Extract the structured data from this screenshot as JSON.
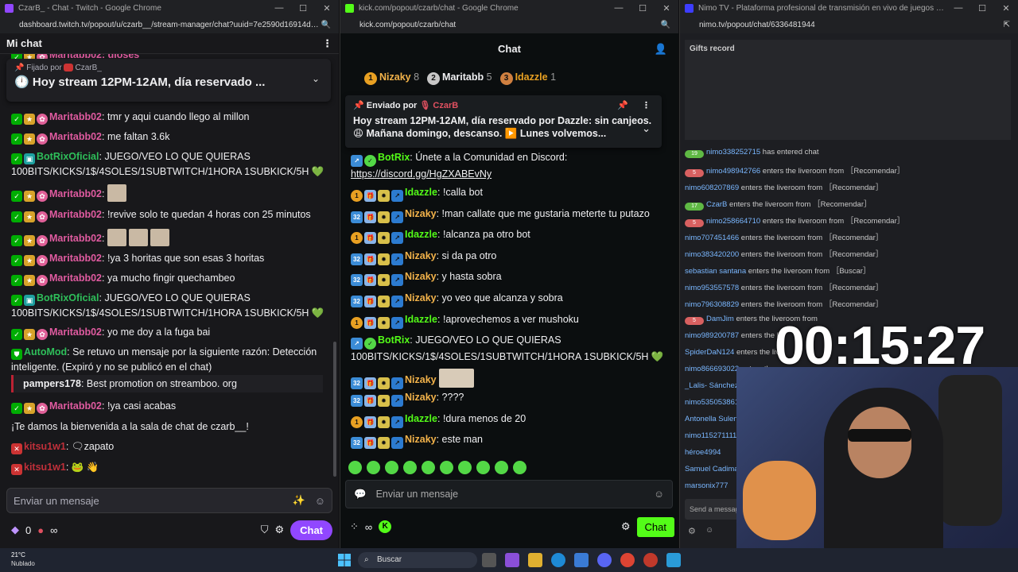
{
  "twitch": {
    "title": "CzarB_ - Chat - Twitch - Google Chrome",
    "url": "dashboard.twitch.tv/popout/u/czarb__/stream-manager/chat?uuid=7e2590d16914d8a5...",
    "header": "Mi chat",
    "top_partial": "Maritabb02: dioses",
    "pinned_by": "Fijado por",
    "pinned_user": "CzarB_",
    "pinned_text": "Hoy stream 12PM-12AM, día reservado ...",
    "messages": [
      {
        "user": "Maritabb02",
        "text": ": tmr y aqui cuando llego al millon",
        "color": "#e05ba0"
      },
      {
        "user": "Maritabb02",
        "text": ": me faltan 3.6k",
        "color": "#e05ba0"
      },
      {
        "user": "BotRixOficial",
        "text": ": JUEGO/VEO LO QUE QUIERAS 100BITS/KICKS/1$/4SOLES/1SUBTWITCH/1HORA 1SUBKICK/5H 💚",
        "color": "#2ebf5a"
      },
      {
        "user": "Maritabb02",
        "text": ":",
        "color": "#e05ba0"
      },
      {
        "user": "Maritabb02",
        "text": ": !revive solo te quedan 4 horas con 25 minutos",
        "color": "#e05ba0"
      },
      {
        "user": "Maritabb02",
        "text": ":",
        "color": "#e05ba0"
      },
      {
        "user": "Maritabb02",
        "text": ": !ya 3 horitas que son esas 3 horitas",
        "color": "#e05ba0"
      },
      {
        "user": "Maritabb02",
        "text": ": ya mucho fingir quechambeo",
        "color": "#e05ba0"
      },
      {
        "user": "BotRixOficial",
        "text": ": JUEGO/VEO LO QUE QUIERAS 100BITS/KICKS/1$/4SOLES/1SUBTWITCH/1HORA 1SUBKICK/5H 💚",
        "color": "#2ebf5a"
      },
      {
        "user": "Maritabb02",
        "text": ": yo me doy a la fuga bai",
        "color": "#e05ba0"
      },
      {
        "user": "AutoMod",
        "text": ": Se retuvo un mensaje por la siguiente razón: Detección inteligente. (Expiró y no se publicó en el chat)",
        "color": "#2ebf5a"
      },
      {
        "user": "Maritabb02",
        "text": ": !ya casi acabas",
        "color": "#e05ba0"
      },
      {
        "user": "kitsu1w1",
        "text": ": 🗨zapato",
        "color": "#c0303a"
      },
      {
        "user": "kitsu1w1",
        "text": ": 🐸 👋",
        "color": "#c0303a"
      }
    ],
    "quote_user": "pampers178",
    "quote_text": ": Best promotion on streamboo. org",
    "welcome": "¡Te damos la bienvenida a la sala de chat de czarb__!",
    "input_placeholder": "Enviar un mensaje",
    "points": "0",
    "infinity": "∞",
    "chat_button": "Chat"
  },
  "kick": {
    "title": "kick.com/popout/czarb/chat - Google Chrome",
    "url": "kick.com/popout/czarb/chat",
    "header": "Chat",
    "leaders": [
      {
        "rank": "1",
        "name": "Nizaky",
        "count": "8",
        "color": "#e8a022",
        "ncolor": "#f2b24a"
      },
      {
        "rank": "2",
        "name": "Maritabb",
        "count": "5",
        "color": "#c7c7c7",
        "ncolor": "#ffffff"
      },
      {
        "rank": "3",
        "name": "Idazzle",
        "count": "1",
        "color": "#d08040",
        "ncolor": "#e8a022"
      }
    ],
    "pinned_by": "Enviado por",
    "pinned_user": "CzarB",
    "pinned_text": "Hoy stream 12PM-12AM, día reservado por Dazzle: sin canjeos. 😩 Mañana domingo, descanso. ▶️ Lunes volvemos...",
    "messages": [
      {
        "user": "BotRix",
        "text": ": Únete a la Comunidad en Discord:",
        "link": "https://discord.gg/HgZXABEvNy",
        "color": "#53fc18"
      },
      {
        "user": "Idazzle",
        "text": ": !calla bot",
        "color": "#53fc18"
      },
      {
        "user": "Nizaky",
        "text": ": !man callate que me gustaria meterte tu putazo",
        "color": "#f2b24a"
      },
      {
        "user": "Idazzle",
        "text": ": !alcanza pa otro bot",
        "color": "#53fc18"
      },
      {
        "user": "Nizaky",
        "text": ": si da pa otro",
        "color": "#f2b24a"
      },
      {
        "user": "Nizaky",
        "text": ": y hasta sobra",
        "color": "#f2b24a"
      },
      {
        "user": "Nizaky",
        "text": ": yo veo que alcanza y sobra",
        "color": "#f2b24a"
      },
      {
        "user": "Idazzle",
        "text": ": !aprovechemos a ver mushoku",
        "color": "#53fc18"
      },
      {
        "user": "BotRix",
        "text": ": JUEGO/VEO LO QUE QUIERAS 100BITS/KICKS/1$/4SOLES/1SUBTWITCH/1HORA 1SUBKICK/5H 💚",
        "color": "#53fc18"
      },
      {
        "user": "Nizaky",
        "text": ":",
        "color": "#f2b24a"
      },
      {
        "user": "Nizaky",
        "text": ": ????",
        "color": "#f2b24a"
      },
      {
        "user": "Idazzle",
        "text": ": !dura menos de 20",
        "color": "#53fc18"
      },
      {
        "user": "Nizaky",
        "text": ": este man",
        "color": "#f2b24a"
      }
    ],
    "input_placeholder": "Enviar un mensaje",
    "infinity": "∞",
    "chat_button": "Chat"
  },
  "nimo": {
    "title": "Nimo TV - Plataforma profesional de transmisión en vivo de juegos - Google Chrome",
    "url": "nimo.tv/popout/chat/6336481944",
    "gifts_title": "Gifts record",
    "rows": [
      {
        "lvl": "19",
        "lc": "green",
        "user": "nimo338252715",
        "text": " has entered chat"
      },
      {
        "lvl": "5",
        "lc": "red",
        "user": "nimo498942766",
        "text": " enters the liveroom from ［Recomendar］"
      },
      {
        "lvl": "",
        "lc": "",
        "user": "nimo608207869",
        "text": " enters the liveroom from ［Recomendar］"
      },
      {
        "lvl": "17",
        "lc": "green",
        "user": "CzarB",
        "text": " enters the liveroom from ［Recomendar］"
      },
      {
        "lvl": "5",
        "lc": "red",
        "user": "nimo258664710",
        "text": " enters the liveroom from ［Recomendar］"
      },
      {
        "lvl": "",
        "lc": "",
        "user": "nimo707451466",
        "text": " enters the liveroom from ［Recomendar］"
      },
      {
        "lvl": "",
        "lc": "",
        "user": "nimo383420200",
        "text": " enters the liveroom from ［Recomendar］"
      },
      {
        "lvl": "",
        "lc": "",
        "user": "sebastian santana",
        "text": " enters the liveroom from ［Buscar］"
      },
      {
        "lvl": "",
        "lc": "",
        "user": "nimo953557578",
        "text": " enters the liveroom from ［Recomendar］"
      },
      {
        "lvl": "",
        "lc": "",
        "user": "nimo796308829",
        "text": " enters the liveroom from ［Recomendar］"
      },
      {
        "lvl": "5",
        "lc": "red",
        "user": "DamJim",
        "text": " enters the liveroom from"
      },
      {
        "lvl": "",
        "lc": "",
        "user": "nimo989200787",
        "text": " enters the liv"
      },
      {
        "lvl": "",
        "lc": "",
        "user": "SpiderDaN124",
        "text": " enters the liv"
      },
      {
        "lvl": "",
        "lc": "",
        "user": "nimo866693022",
        "text": " enters the"
      },
      {
        "lvl": "",
        "lc": "",
        "user": "_Lalis- Sánchez_",
        "text": ""
      },
      {
        "lvl": "",
        "lc": "",
        "user": "nimo535053861",
        "text": ""
      },
      {
        "lvl": "",
        "lc": "",
        "user": "Antonella Sulent",
        "text": ""
      },
      {
        "lvl": "",
        "lc": "",
        "user": "nimo115271111",
        "text": ""
      },
      {
        "lvl": "",
        "lc": "",
        "user": "héroe4994",
        "text": ""
      },
      {
        "lvl": "",
        "lc": "",
        "user": "Samuel Cadima",
        "text": ""
      },
      {
        "lvl": "",
        "lc": "",
        "user": "marsonix777",
        "text": ""
      }
    ],
    "input_placeholder": "Send a message",
    "timer": "00:15:27"
  },
  "taskbar": {
    "temp": "21°C",
    "weather": "Nublado",
    "search": "Buscar"
  }
}
